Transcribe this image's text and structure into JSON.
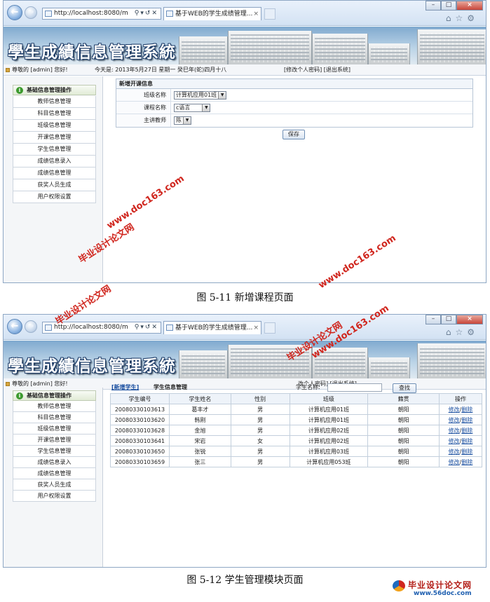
{
  "browser": {
    "address": "http://localhost:8080/m",
    "tab_title": "基于WEB的学生成绩管理...",
    "toolbar_icons": [
      "home-icon",
      "star-icon",
      "gear-icon"
    ]
  },
  "app": {
    "title": "學生成績信息管理系統",
    "greeting": "尊敬的 [admin] 您好!",
    "date_text": "今天是: 2013年5月27日 星期一 癸巳年(蛇)四月十八",
    "links": "[修改个人密码] [退出系统]",
    "links_cut": "改个人密码] [退出系统]",
    "menu_header": "基础信息管理操作",
    "menu_items": [
      "教师信息管理",
      "科目信息管理",
      "班级信息管理",
      "开课信息管理",
      "学生信息管理",
      "成绩信息录入",
      "成绩信息管理",
      "获奖人员生成",
      "用户权限设置"
    ]
  },
  "screen1": {
    "panel_title": "新增开课信息",
    "rows": [
      {
        "label": "班级名称",
        "value": "计算机应用01班"
      },
      {
        "label": "课程名称",
        "value": "c语言"
      },
      {
        "label": "主讲教师",
        "value": "陈"
      }
    ],
    "save": "保存",
    "caption": "图 5-11  新增课程页面"
  },
  "screen2": {
    "add_link": "[新增学生]",
    "title": "学生信息管理",
    "search_label": "学生名称:",
    "search_button": "查找",
    "columns": [
      "学生编号",
      "学生姓名",
      "性别",
      "班级",
      "籍贯",
      "操作"
    ],
    "rows": [
      [
        "20080330103613",
        "葛丰才",
        "男",
        "计算机应用01班",
        "朝阳"
      ],
      [
        "20080330103620",
        "韩刚",
        "男",
        "计算机应用01班",
        "朝阳"
      ],
      [
        "20080330103628",
        "金旭",
        "男",
        "计算机应用02班",
        "朝阳"
      ],
      [
        "20080330103641",
        "宋岩",
        "女",
        "计算机应用02班",
        "朝阳"
      ],
      [
        "20080330103650",
        "张锐",
        "男",
        "计算机应用03班",
        "朝阳"
      ],
      [
        "20080330103659",
        "张三",
        "男",
        "计算机应用053班",
        "朝阳"
      ]
    ],
    "edit_label": "修改",
    "delete_label": "删除",
    "caption": "图 5-12  学生管理模块页面"
  },
  "watermarks": {
    "cn": "毕业设计论文网",
    "url": "www.doc163.com"
  },
  "footer_logo": {
    "name": "毕业设计论文网",
    "url": "www.56doc.com"
  }
}
